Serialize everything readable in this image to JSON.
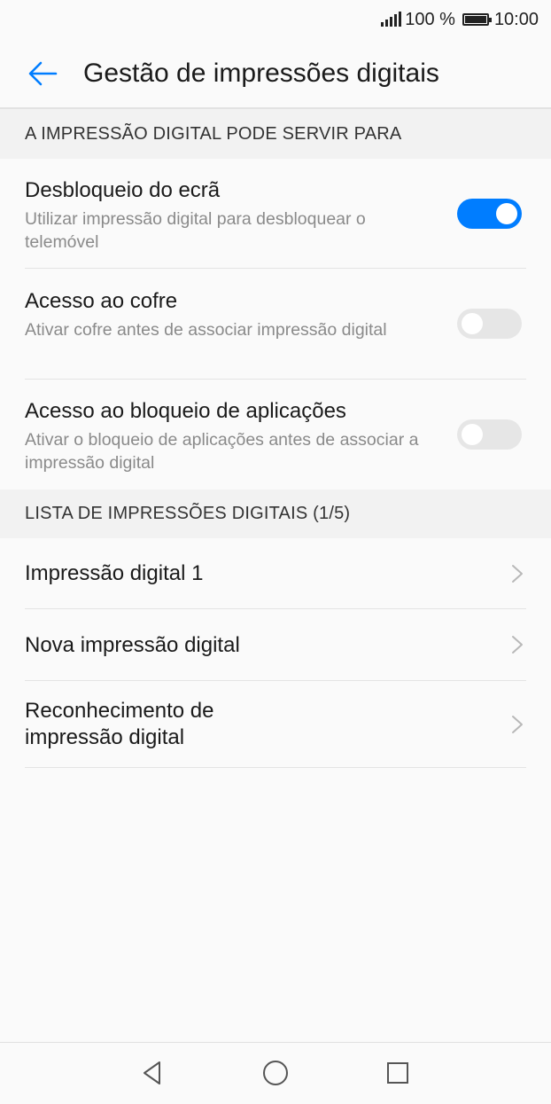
{
  "status_bar": {
    "battery_percent": "100 %",
    "time": "10:00"
  },
  "header": {
    "title": "Gestão de impressões digitais",
    "back_icon": "arrow-back-icon"
  },
  "section1": {
    "header": "A IMPRESSÃO DIGITAL PODE SERVIR PARA",
    "items": [
      {
        "title": "Desbloqueio do ecrã",
        "subtitle": "Utilizar impressão digital para desbloquear o telemóvel",
        "enabled": true
      },
      {
        "title": "Acesso ao cofre",
        "subtitle": "Ativar cofre antes de associar impressão digital",
        "enabled": false
      },
      {
        "title": "Acesso ao bloqueio de aplicações",
        "subtitle": "Ativar o bloqueio de aplicações antes de associar a impressão digital",
        "enabled": false
      }
    ]
  },
  "section2": {
    "header": "LISTA DE IMPRESSÕES DIGITAIS (1/5)",
    "items": [
      {
        "title": "Impressão digital 1"
      },
      {
        "title": "Nova impressão digital"
      },
      {
        "title": "Reconhecimento de\nimpressão digital"
      }
    ]
  },
  "colors": {
    "accent": "#007dff",
    "toggle_off": "#e6e6e6",
    "background": "#fafafa",
    "section_bg": "#f2f2f2"
  },
  "nav_bar": {
    "icons": [
      "back-triangle-icon",
      "home-circle-icon",
      "recents-square-icon"
    ]
  }
}
